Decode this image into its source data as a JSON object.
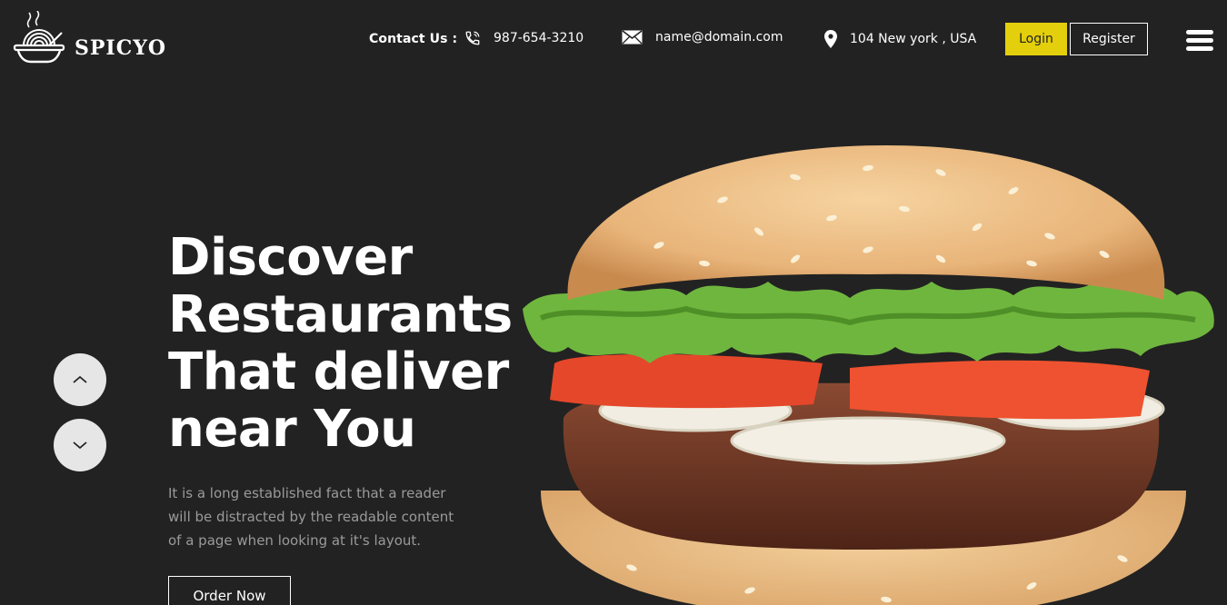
{
  "brand": {
    "name": "SPICYO",
    "logo_icon": "noodle-bowl-icon"
  },
  "header": {
    "contact_label": "Contact Us :",
    "phone": "987-654-3210",
    "email": "name@domain.com",
    "address": "104 New york , USA",
    "login_label": "Login",
    "register_label": "Register",
    "icons": [
      "phone-icon",
      "mail-icon",
      "location-pin-icon",
      "menu-icon"
    ]
  },
  "hero": {
    "title_lines": [
      "Discover",
      "Restaurants",
      "That deliver",
      "near You"
    ],
    "description_lines": [
      "It is a long established fact that a reader",
      "will be distracted by the readable content",
      "of a page when looking at it's layout."
    ],
    "cta_label": "Order Now",
    "image_subject": "hamburger"
  },
  "slider": {
    "controls": [
      "chevron-up-icon",
      "chevron-down-icon"
    ]
  },
  "colors": {
    "background": "#222222",
    "accent": "#e4cf0c",
    "text": "#ffffff",
    "muted_text": "#9a9a9a",
    "arrow_bg": "#e6e6e6"
  }
}
